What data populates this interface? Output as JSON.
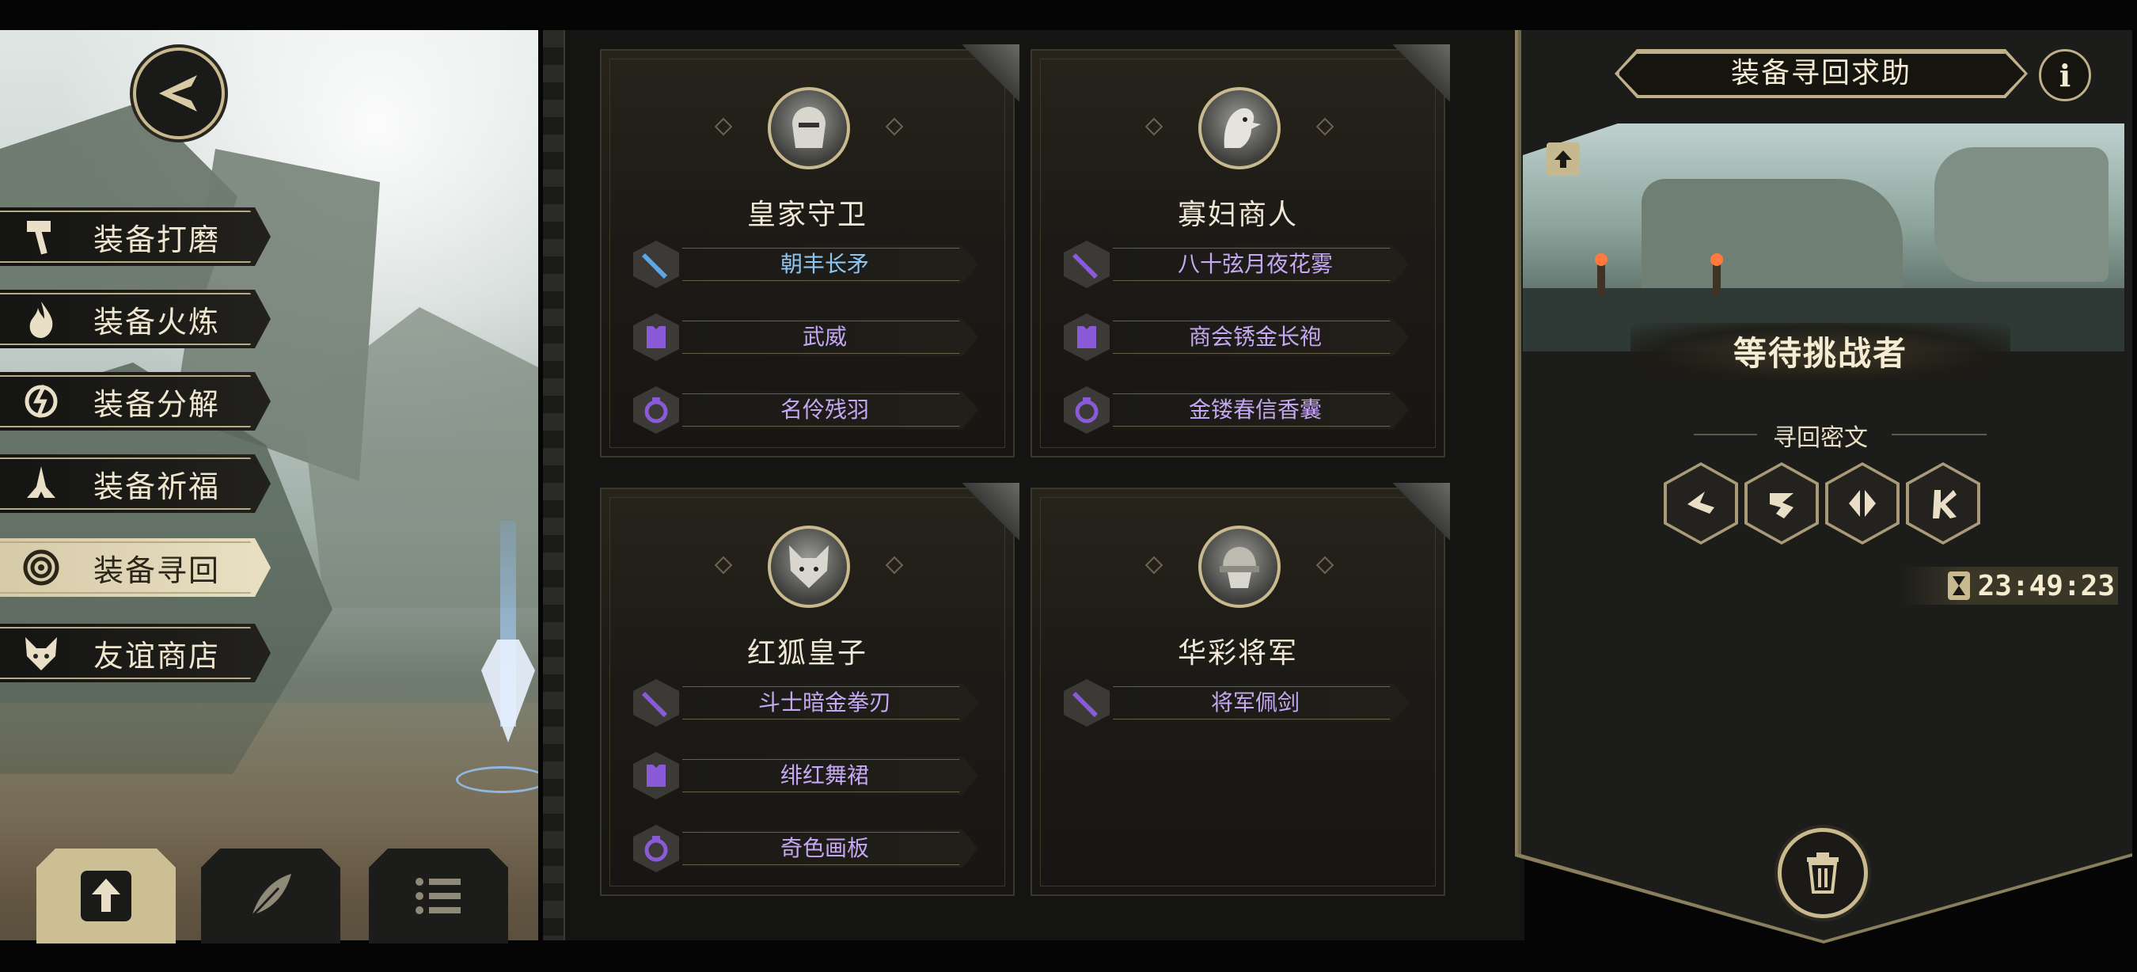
{
  "left_menu": {
    "items": [
      {
        "label": "装备打磨",
        "icon": "hammer-icon",
        "active": false
      },
      {
        "label": "装备火炼",
        "icon": "flame-icon",
        "active": false
      },
      {
        "label": "装备分解",
        "icon": "break-icon",
        "active": false
      },
      {
        "label": "装备祈福",
        "icon": "pray-hands-icon",
        "active": false
      },
      {
        "label": "装备寻回",
        "icon": "spiral-icon",
        "active": true
      },
      {
        "label": "友谊商店",
        "icon": "fox-icon",
        "active": false
      }
    ]
  },
  "bottom_tabs": [
    {
      "icon": "upload-icon",
      "active": true
    },
    {
      "icon": "feather-icon",
      "active": false
    },
    {
      "icon": "list-icon",
      "active": false
    }
  ],
  "cards": [
    {
      "name": "皇家守卫",
      "avatar": "knight-avatar",
      "items": [
        {
          "label": "朝丰长矛",
          "icon": "sword-icon",
          "rarity": "blue"
        },
        {
          "label": "武威",
          "icon": "armor-icon",
          "rarity": "purple"
        },
        {
          "label": "名伶残羽",
          "icon": "ring-icon",
          "rarity": "purple"
        }
      ]
    },
    {
      "name": "寡妇商人",
      "avatar": "bird-avatar",
      "items": [
        {
          "label": "八十弦月夜花雾",
          "icon": "sword-icon",
          "rarity": "purple"
        },
        {
          "label": "商会锈金长袍",
          "icon": "armor-icon",
          "rarity": "purple"
        },
        {
          "label": "金镂春信香囊",
          "icon": "ring-icon",
          "rarity": "purple"
        }
      ]
    },
    {
      "name": "红狐皇子",
      "avatar": "fox-avatar",
      "items": [
        {
          "label": "斗士暗金拳刃",
          "icon": "sword-icon",
          "rarity": "purple"
        },
        {
          "label": "绯红舞裙",
          "icon": "armor-icon",
          "rarity": "purple"
        },
        {
          "label": "奇色画板",
          "icon": "ring-icon",
          "rarity": "purple"
        }
      ]
    },
    {
      "name": "华彩将军",
      "avatar": "general-avatar",
      "items": [
        {
          "label": "将军佩剑",
          "icon": "sword-icon",
          "rarity": "purple"
        }
      ]
    }
  ],
  "right_panel": {
    "title": "装备寻回求助",
    "info_icon": "info-icon",
    "status": "等待挑战者",
    "cipher_title": "寻回密文",
    "runes": [
      "rune-1-icon",
      "rune-2-icon",
      "rune-3-icon",
      "rune-4-icon"
    ],
    "timer": "23:49:23"
  },
  "colors": {
    "accent_gold": "#c9b98f",
    "item_blue": "#8cc4f2",
    "item_purple": "#c4a8f2",
    "icon_purple": "#8a5ad8",
    "icon_blue": "#5aa8e6"
  }
}
